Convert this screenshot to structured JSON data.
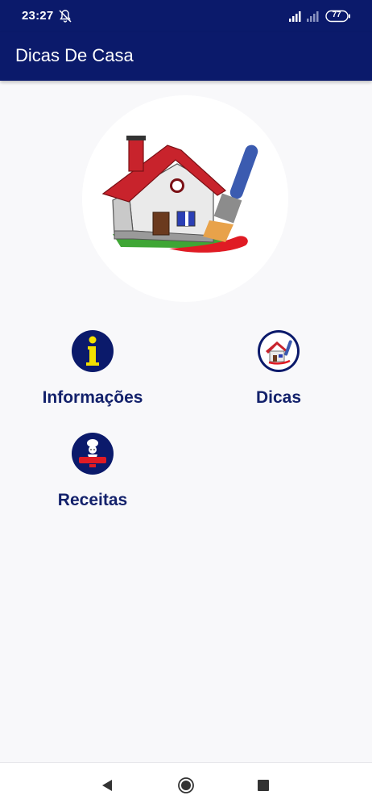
{
  "status_bar": {
    "time": "23:27",
    "battery": "77",
    "icons": [
      "notifications-off-icon",
      "signal-icon",
      "signal-weak-icon",
      "battery-icon"
    ]
  },
  "app_bar": {
    "title": "Dicas De Casa"
  },
  "hero": {
    "icon": "house-paintbrush-icon"
  },
  "menu": {
    "items": [
      {
        "label": "Informações",
        "icon": "info-icon"
      },
      {
        "label": "Dicas",
        "icon": "house-icon"
      },
      {
        "label": "Receitas",
        "icon": "chef-icon"
      }
    ]
  },
  "nav_bar": {
    "icons": [
      "back-icon",
      "home-icon",
      "recents-icon"
    ]
  },
  "colors": {
    "primary": "#0b1a6b",
    "label": "#13216b",
    "background": "#f8f8fa",
    "info_yellow": "#f4e000"
  }
}
